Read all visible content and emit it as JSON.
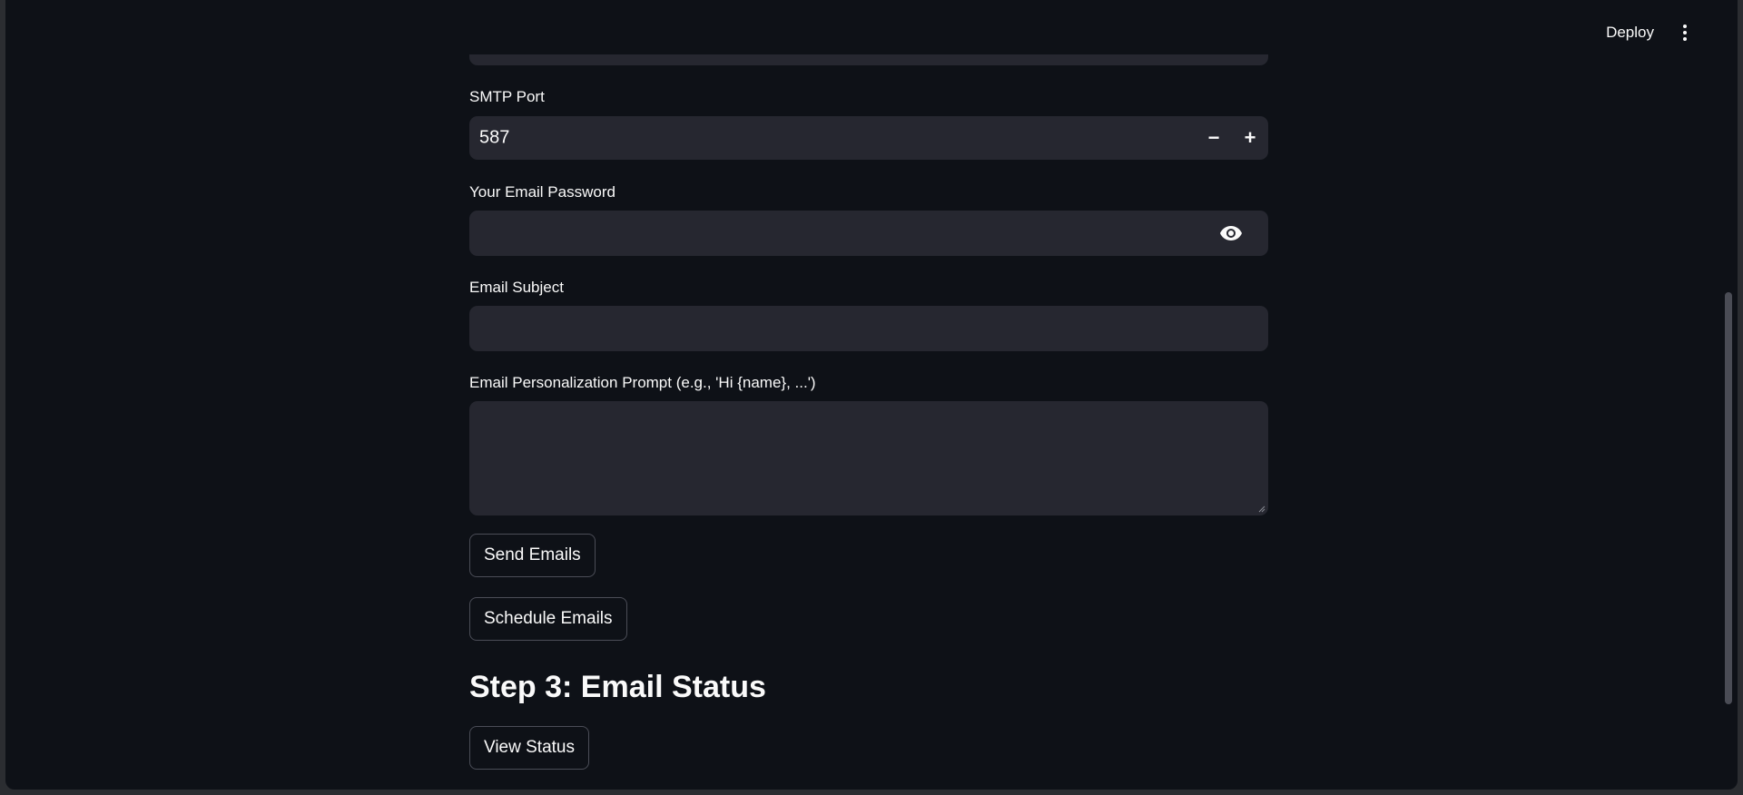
{
  "header": {
    "deploy_label": "Deploy"
  },
  "form": {
    "smtp_port": {
      "label": "SMTP Port",
      "value": "587",
      "decrement": "−",
      "increment": "+"
    },
    "password": {
      "label": "Your Email Password",
      "value": ""
    },
    "subject": {
      "label": "Email Subject",
      "value": ""
    },
    "prompt": {
      "label": "Email Personalization Prompt (e.g., 'Hi {name}, ...')",
      "value": ""
    },
    "send_label": "Send Emails",
    "schedule_label": "Schedule Emails"
  },
  "status_section": {
    "heading": "Step 3: Email Status",
    "view_label": "View Status"
  },
  "icons": {
    "menu": "kebab-menu-icon",
    "password_toggle": "eye-icon"
  },
  "colors": {
    "background": "#0e1117",
    "input_background": "#262730",
    "text": "#fafafa",
    "button_border": "#4b4d57"
  }
}
